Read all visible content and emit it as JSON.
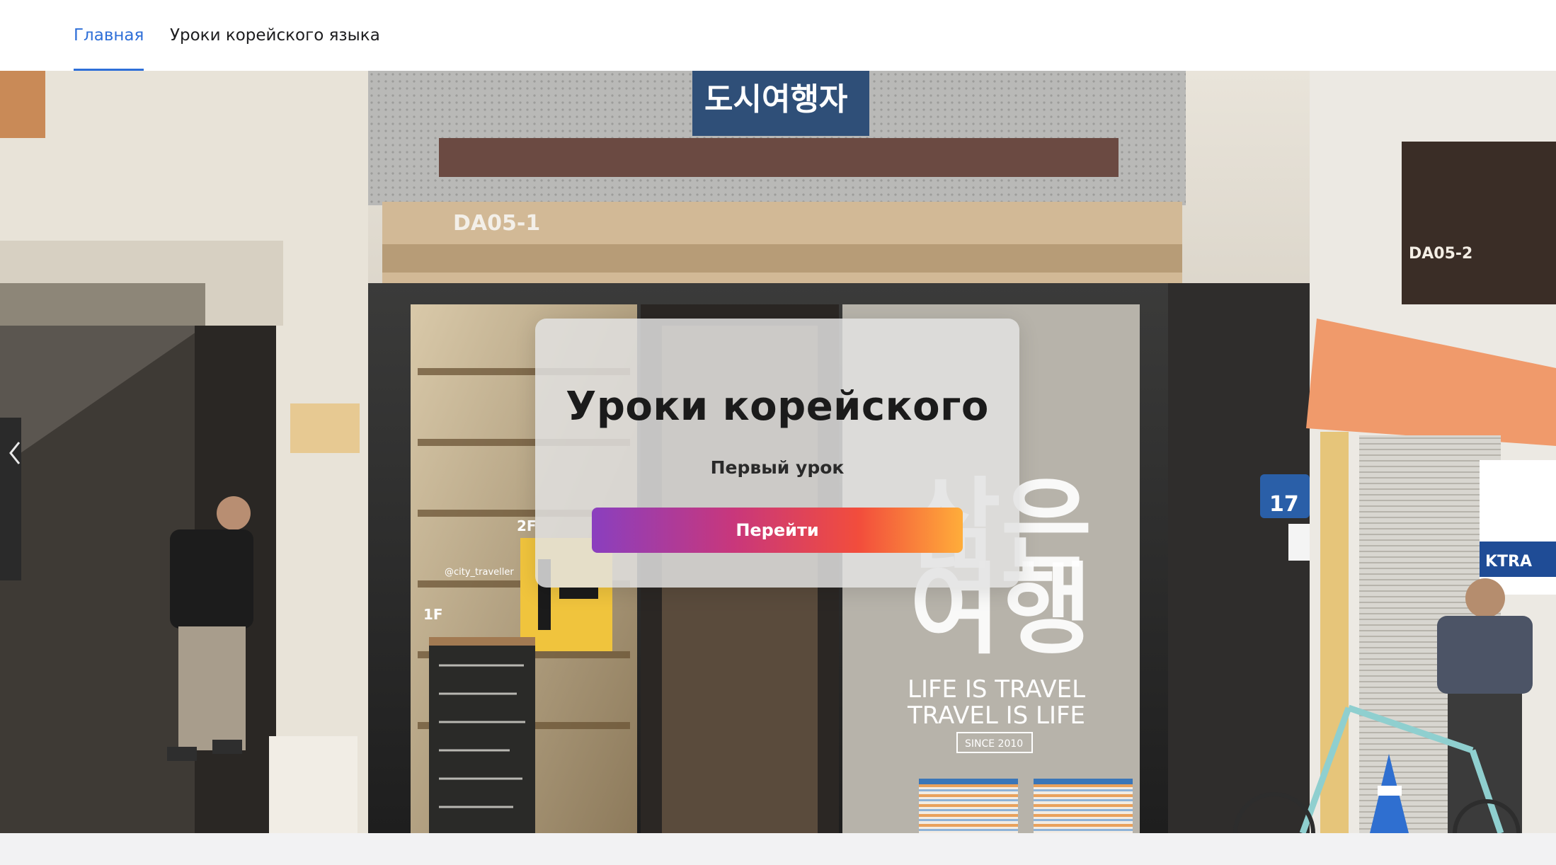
{
  "nav": {
    "items": [
      {
        "label": "Главная",
        "active": true
      },
      {
        "label": "Уроки корейского языка",
        "active": false
      }
    ]
  },
  "hero": {
    "image_text": {
      "storefront_sign": "DA05-1",
      "neighbor_sign": "DA05-2",
      "window_slogan_1": "LIFE IS TRAVEL",
      "window_slogan_2": "TRAVEL IS LIFE",
      "window_since": "SINCE 2010",
      "window_korean_1": "삶은",
      "window_korean_2": "여행",
      "top_banner": "도시여행자",
      "instagram_handle": "@city_traveller",
      "floor_2f": "2F",
      "floor_1f": "1F",
      "address_number": "17",
      "shop_sign_right": "KTRA"
    },
    "prev_icon": "chevron-left-icon"
  },
  "card": {
    "title": "Уроки корейского",
    "subtitle": "Первый урок",
    "button_label": "Перейти"
  },
  "colors": {
    "nav_active": "#2e6fd8",
    "button_gradient": [
      "#8a3fbf",
      "#c8377c",
      "#f24d3c",
      "#ffad3a"
    ]
  }
}
